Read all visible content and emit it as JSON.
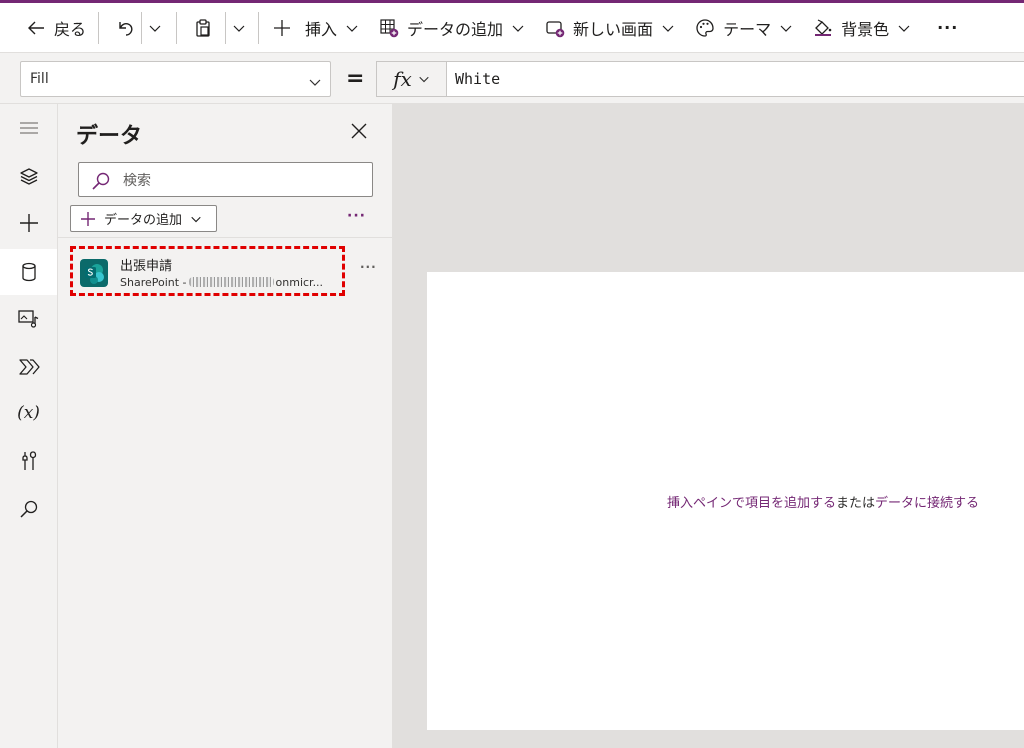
{
  "toolbar": {
    "back_label": "戻る",
    "insert_label": "挿入",
    "add_data_label": "データの追加",
    "new_screen_label": "新しい画面",
    "theme_label": "テーマ",
    "background_label": "背景色",
    "more_label": "···"
  },
  "formula": {
    "property": "Fill",
    "equals": "=",
    "fx_label": "fx",
    "value": "White"
  },
  "rail": {
    "items": [
      "menu-icon",
      "layers-icon",
      "plus-icon",
      "database-icon",
      "media-icon",
      "power-automate-icon",
      "variables-icon",
      "tools-icon",
      "search-icon"
    ],
    "active": "database-icon",
    "variables_glyph": "(x)"
  },
  "data_pane": {
    "title": "データ",
    "search_placeholder": "検索",
    "add_data_label": "データの追加",
    "more_label": "···",
    "datasource": {
      "name": "出張申請",
      "subtitle_prefix": "SharePoint -",
      "subtitle_suffix": "onmicr...",
      "more_label": "···",
      "icon": "sharepoint-icon",
      "icon_color": "#0b6a6a"
    }
  },
  "canvas": {
    "hint_insert": "挿入ペインで項目を追加する",
    "hint_or": "または",
    "hint_connect": "データに接続する"
  },
  "colors": {
    "accent": "#742774",
    "highlight_border": "#e00000"
  }
}
